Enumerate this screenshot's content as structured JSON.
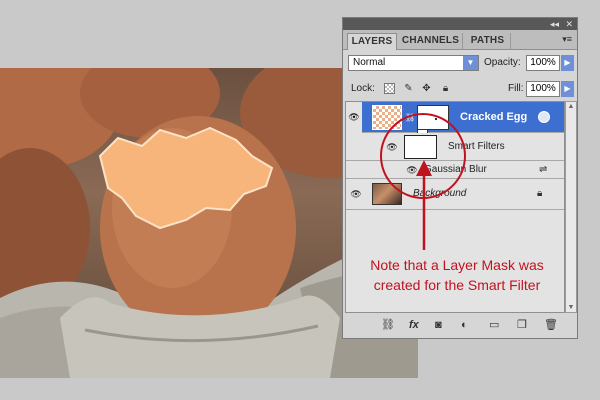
{
  "panel": {
    "collapse_glyph": "◂◂",
    "close_glyph": "✕",
    "tabs": [
      "LAYERS",
      "CHANNELS",
      "PATHS"
    ],
    "menu_glyph": "▾≡",
    "blend_mode": "Normal",
    "opacity_label": "Opacity:",
    "opacity_value": "100%",
    "lock_label": "Lock:",
    "fill_label": "Fill:",
    "fill_value": "100%",
    "layers": [
      {
        "name": "Cracked Egg",
        "type": "smart-object",
        "selected": true
      },
      {
        "name": "Smart Filters",
        "type": "smart-filters-mask"
      },
      {
        "name": "Gaussian Blur",
        "type": "filter"
      },
      {
        "name": "Background",
        "type": "background",
        "locked": true
      }
    ],
    "bottom_tools": [
      "link-icon",
      "fx-icon",
      "layer-mask-icon",
      "adjustment-layer-icon",
      "new-group-icon",
      "new-layer-icon",
      "trash-icon"
    ],
    "fx_label": "fx"
  },
  "annotation": {
    "note": "Note that a Layer Mask was created for the Smart Filter",
    "color": "#c1121f"
  },
  "colors": {
    "selected_layer": "#3d6fd0",
    "panel_bg": "#d6d6d6",
    "page_bg": "#c9c9c9"
  }
}
